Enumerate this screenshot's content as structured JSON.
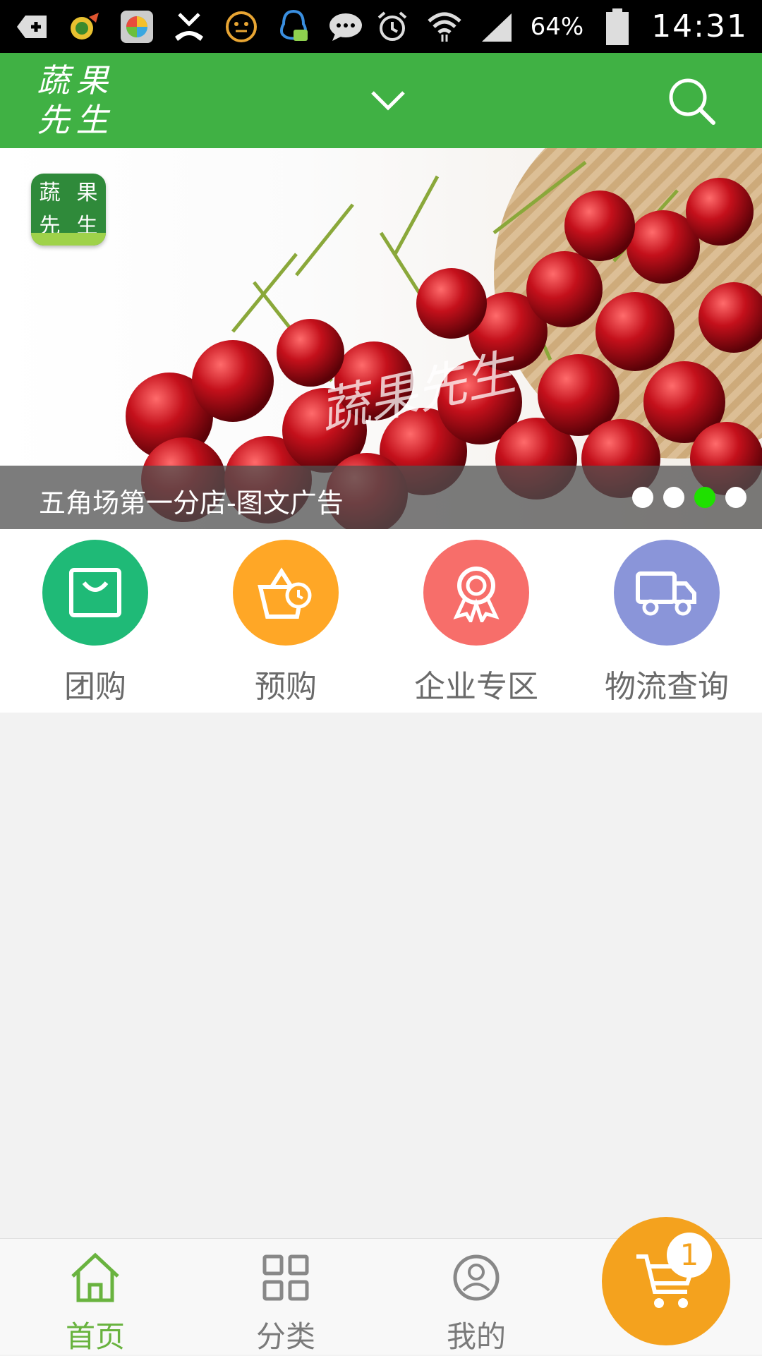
{
  "status_bar": {
    "battery_percent": "64%",
    "time": "14:31"
  },
  "header": {
    "logo_chars": [
      "蔬",
      "果",
      "先",
      "生"
    ],
    "brand_color": "#40b144"
  },
  "banner": {
    "badge_chars": [
      "蔬",
      "果",
      "先",
      "生"
    ],
    "watermark": "蔬果先生",
    "caption": "五角场第一分店-图文广告",
    "slide_count": 4,
    "active_slide": 3
  },
  "quick_menu": [
    {
      "label": "团购",
      "icon": "shopping-bag-icon",
      "color": "#1fba77"
    },
    {
      "label": "预购",
      "icon": "basket-clock-icon",
      "color": "#ffa726"
    },
    {
      "label": "企业专区",
      "icon": "award-ribbon-icon",
      "color": "#f76e6a"
    },
    {
      "label": "物流查询",
      "icon": "delivery-truck-icon",
      "color": "#8a95d9"
    }
  ],
  "bottom_nav": [
    {
      "label": "首页",
      "icon": "home-icon",
      "active": true
    },
    {
      "label": "分类",
      "icon": "grid-icon",
      "active": false
    },
    {
      "label": "我的",
      "icon": "user-icon",
      "active": false
    }
  ],
  "cart": {
    "count": "1",
    "color": "#f4a21e"
  }
}
